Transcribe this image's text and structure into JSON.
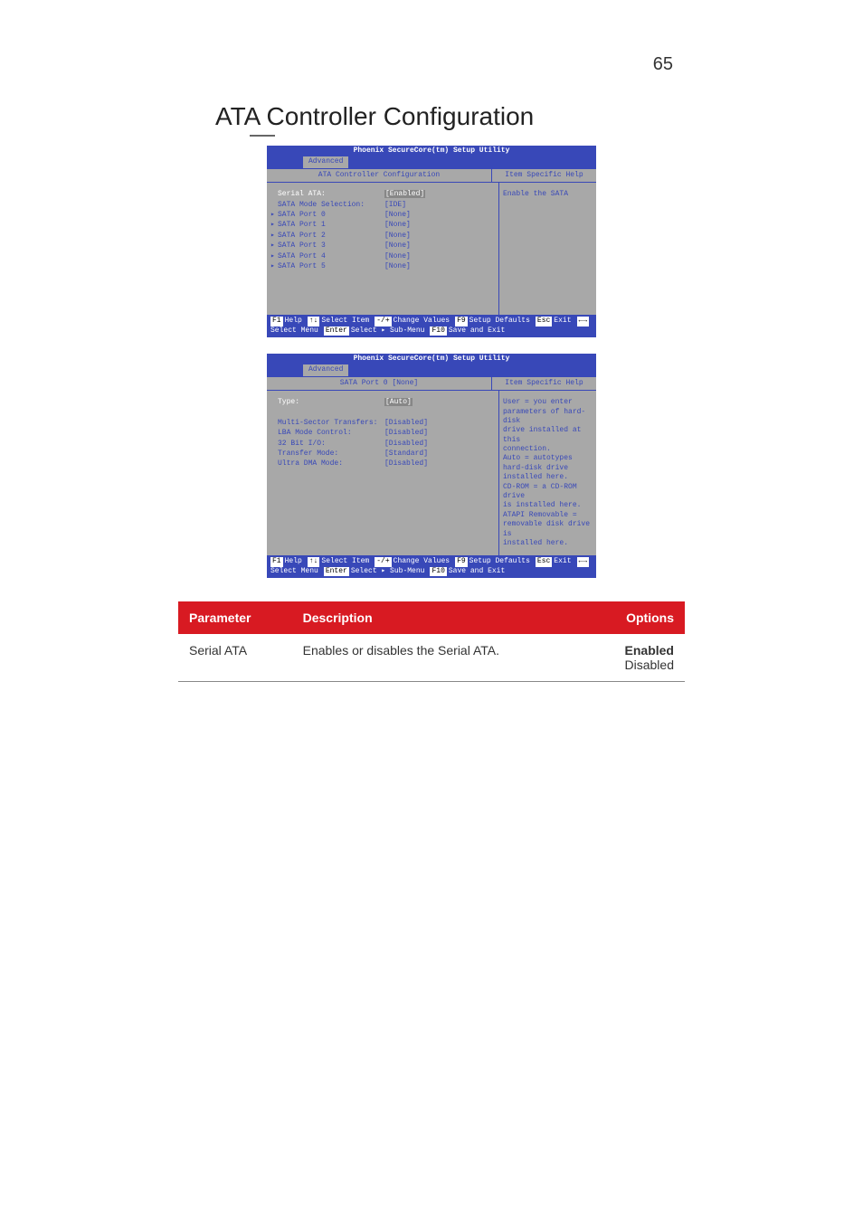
{
  "page_number": "65",
  "heading": "ATA Controller Configuration",
  "bios1": {
    "product": "Phoenix SecureCore(tm) Setup Utility",
    "tab": "Advanced",
    "section_title": "ATA Controller Configuration",
    "help_header": "Item Specific Help",
    "help_text": "Enable the SATA",
    "rows": [
      {
        "arrow": "",
        "label": "Serial ATA:",
        "val": "[Enabled]",
        "selected": true
      },
      {
        "arrow": "",
        "label": "SATA Mode Selection:",
        "val": "[IDE]"
      },
      {
        "arrow": "▸",
        "label": "SATA Port 0",
        "val": "[None]"
      },
      {
        "arrow": "▸",
        "label": "SATA Port 1",
        "val": "[None]"
      },
      {
        "arrow": "▸",
        "label": "SATA Port 2",
        "val": "[None]"
      },
      {
        "arrow": "▸",
        "label": "SATA Port 3",
        "val": "[None]"
      },
      {
        "arrow": "▸",
        "label": "SATA Port 4",
        "val": "[None]"
      },
      {
        "arrow": "▸",
        "label": "SATA Port 5",
        "val": "[None]"
      }
    ],
    "footer": [
      {
        "key": "F1",
        "act": "Help"
      },
      {
        "key": "↑↓",
        "act": "Select Item"
      },
      {
        "key": "-/+",
        "act": "Change Values"
      },
      {
        "key": "F9",
        "act": "Setup Defaults"
      },
      {
        "key": "Esc",
        "act": "Exit"
      },
      {
        "key": "←→",
        "act": "Select Menu"
      },
      {
        "key": "Enter",
        "act": "Select ▸ Sub-Menu"
      },
      {
        "key": "F10",
        "act": "Save and Exit"
      }
    ]
  },
  "bios2": {
    "product": "Phoenix SecureCore(tm) Setup Utility",
    "tab": "Advanced",
    "section_title": "SATA Port 0  [None]",
    "help_header": "Item Specific Help",
    "help_text": "User = you enter\nparameters of hard-disk\ndrive installed at this\nconnection.\nAuto = autotypes\nhard-disk drive\ninstalled here.\nCD-ROM = a CD-ROM drive\nis installed here.\nATAPI Removable =\nremovable disk drive is\ninstalled here.",
    "rows": [
      {
        "arrow": "",
        "label": "Type:",
        "val": "[Auto]",
        "selected": true
      },
      {
        "arrow": "",
        "label": "",
        "val": ""
      },
      {
        "arrow": "",
        "label": "Multi-Sector Transfers:",
        "val": "[Disabled]"
      },
      {
        "arrow": "",
        "label": "LBA Mode Control:",
        "val": "[Disabled]"
      },
      {
        "arrow": "",
        "label": "32 Bit I/O:",
        "val": "[Disabled]"
      },
      {
        "arrow": "",
        "label": "Transfer Mode:",
        "val": "[Standard]"
      },
      {
        "arrow": "",
        "label": "Ultra DMA Mode:",
        "val": "[Disabled]"
      }
    ],
    "footer": [
      {
        "key": "F1",
        "act": "Help"
      },
      {
        "key": "↑↓",
        "act": "Select Item"
      },
      {
        "key": "-/+",
        "act": "Change Values"
      },
      {
        "key": "F9",
        "act": "Setup Defaults"
      },
      {
        "key": "Esc",
        "act": "Exit"
      },
      {
        "key": "←→",
        "act": "Select Menu"
      },
      {
        "key": "Enter",
        "act": "Select ▸ Sub-Menu"
      },
      {
        "key": "F10",
        "act": "Save and Exit"
      }
    ]
  },
  "table": {
    "headers": {
      "param": "Parameter",
      "desc": "Description",
      "opts": "Options"
    },
    "rows": [
      {
        "param": "Serial ATA",
        "desc": "Enables or disables the Serial ATA.",
        "opt1": "Enabled",
        "opt2": "Disabled"
      }
    ]
  }
}
